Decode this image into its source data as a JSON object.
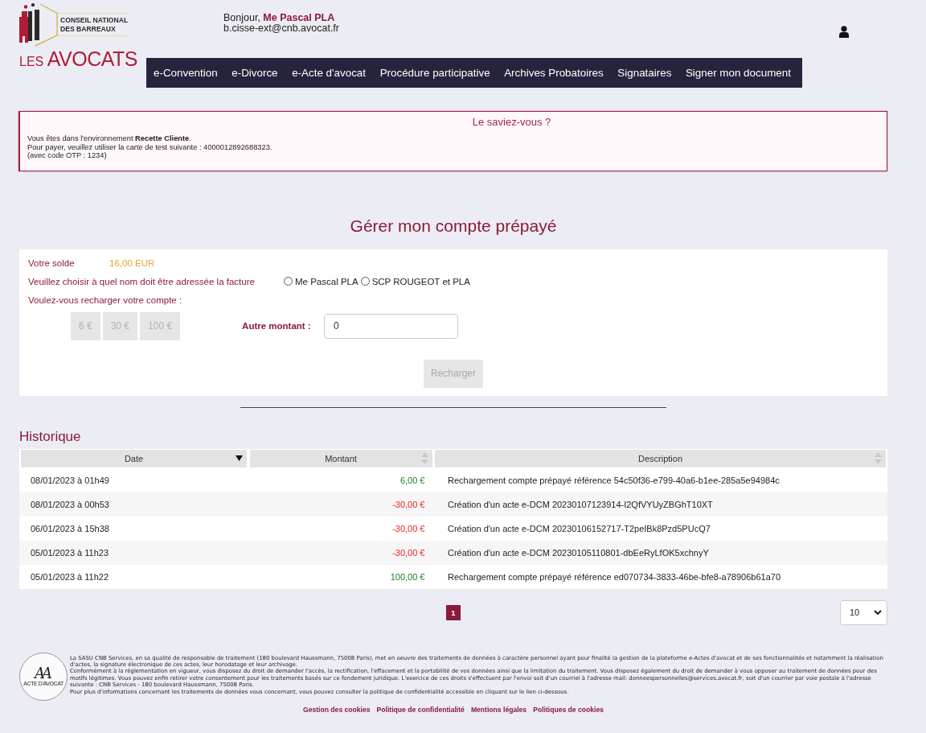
{
  "header": {
    "logo": {
      "org_lines": [
        "CONSEIL NATIONAL",
        "DES BARREAUX"
      ],
      "brand_prefix": "LES",
      "brand": "AVOCATS"
    },
    "greeting": "Bonjour, **Me Pascal PLA**",
    "email": "b.cisse-ext@cnb.avocat.fr"
  },
  "nav": [
    "e-Convention",
    "e-Divorce",
    "e-Acte d'avocat",
    "Procédure participative",
    "Archives Probatoires",
    "Signataires",
    "Signer mon document"
  ],
  "notice": {
    "title": "Le saviez-vous ?",
    "lines": [
      "Vous êtes dans l'environnement **Recette Cliente**.",
      "Pour payer, veuillez utiliser la carte de test suivante : 4000012892688323.",
      "(avec code OTP : 1234)"
    ]
  },
  "page_title": "Gérer mon compte prépayé",
  "account": {
    "balance_label": "Votre solde",
    "balance": "16,00 EUR",
    "invoice_label": "Veuillez choisir à quel nom doit être adressée la facture",
    "invoice_options": [
      {
        "label": "Me Pascal PLA",
        "selected": false
      },
      {
        "label": "SCP ROUGEOT et PLA",
        "selected": false
      }
    ],
    "recharge_label": "Voulez-vous recharger votre compte :",
    "amount_buttons": [
      {
        "label": "6 €",
        "disabled": true
      },
      {
        "label": "30 €",
        "disabled": true
      },
      {
        "label": "100 €",
        "disabled": true
      }
    ],
    "other_amount_label": "Autre montant :",
    "other_amount_value": "0",
    "submit": {
      "label": "Recharger",
      "disabled": true
    }
  },
  "history": {
    "title": "Historique",
    "columns": [
      {
        "label": "Date",
        "sorted": true
      },
      {
        "label": "Montant",
        "sorted": false
      },
      {
        "label": "Description",
        "sorted": false
      }
    ],
    "rows": [
      {
        "date": "08/01/2023 à 01h49",
        "amount": "6,00 €",
        "kind": "credit",
        "description": "Rechargement compte prépayé référence 54c50f36-e799-40a6-b1ee-285a5e94984c"
      },
      {
        "date": "08/01/2023 à 00h53",
        "amount": "-30,00 €",
        "kind": "debit",
        "description": "Création d'un acte e-DCM 20230107123914-I2QfVYUyZBGhT10XT"
      },
      {
        "date": "06/01/2023 à 15h38",
        "amount": "-30,00 €",
        "kind": "debit",
        "description": "Création d'un acte e-DCM 20230106152717-T2peIBk8Pzd5PUcQ7"
      },
      {
        "date": "05/01/2023 à 11h23",
        "amount": "-30,00 €",
        "kind": "debit",
        "description": "Création d'un acte e-DCM 20230105110801-dbEeRyLfOK5xchnyY"
      },
      {
        "date": "05/01/2023 à 11h22",
        "amount": "100,00 €",
        "kind": "credit",
        "description": "Rechargement compte prépayé référence ed070734-3833-46be-bfe8-a78906b61a70"
      }
    ]
  },
  "pagination": {
    "pages": [
      {
        "label": "1",
        "selected": true
      }
    ],
    "page_size": "10"
  },
  "footer": {
    "logo_monogram": "AA",
    "logo_caption": "ACTE D'AVOCAT",
    "paragraphs": [
      "La SASU CNB Services, en sa qualité de responsable de traitement (180 boulevard Haussmann, 75008 Paris), met en oeuvre des traitements de données à caractère personnel ayant pour finalité la gestion de la plateforme e-Actes d'avocat et de ses fonctionnalités et notamment la réalisation d'actes, la signature électronique de ces actes, leur horodatage et leur archivage.",
      "Conformément à la réglementation en vigueur, vous disposez du droit de demander l'accès, la rectification, l'effacement et la portabilité de vos données ainsi que la limitation du traitement. Vous disposez également du droit de demander à vous opposer au traitement de données pour des motifs légitimes. Vous pouvez enfin retirer votre consentement pour les traitements basés sur ce fondement juridique. L'exercice de ces droits s'effectuent par l'envoi soit d'un courriel à l'adresse mail: donneespersonnelles@services.avocat.fr, soit d'un courrier par voie postale à l'adresse suivante : CNB Services - 180 boulevard Haussmann, 75008 Paris.",
      "Pour plus d'informations concernant les traitements de données vous concernant, vous pouvez consulter la politique de confidentialité accessible en cliquant sur le lien ci-dessous."
    ],
    "links": [
      "Gestion des cookies",
      "Politique de confidentialité",
      "Mentions légales",
      "Politiques de cookies"
    ]
  }
}
